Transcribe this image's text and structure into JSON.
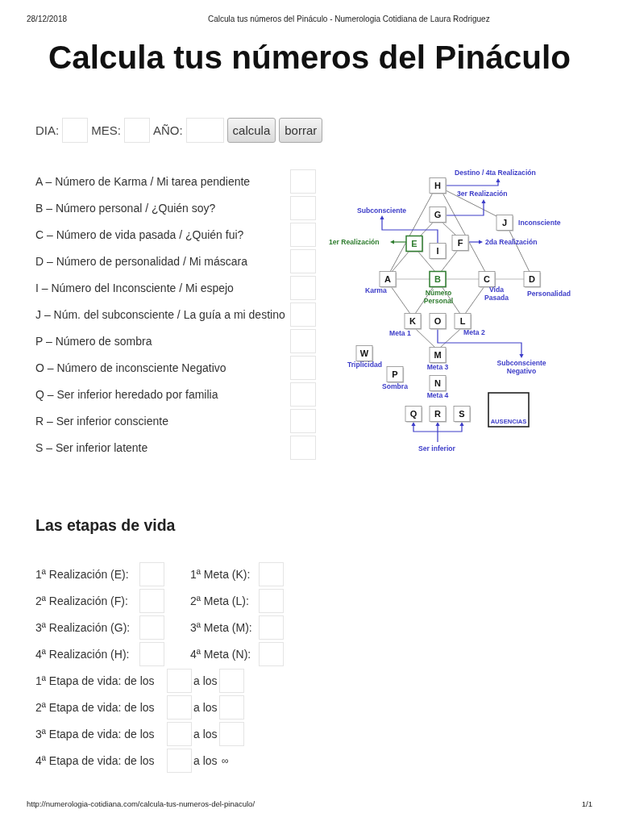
{
  "header": {
    "date": "28/12/2018",
    "title": "Calcula tus números del Pináculo - Numerologia Cotidiana de Laura Rodriguez"
  },
  "title": "Calcula tus números del Pináculo",
  "date_form": {
    "fields": [
      {
        "label": "DIA:"
      },
      {
        "label": "MES:"
      },
      {
        "label": "AÑO:"
      }
    ],
    "buttons": [
      "calcula",
      "borrar"
    ]
  },
  "numbers": [
    "A – Número de Karma / Mi tarea pendiente",
    "B – Número personal / ¿Quién soy?",
    "C – Número de vida pasada / ¿Quién fui?",
    "D – Número de personalidad / Mi máscara",
    "I – Número del Inconsciente / Mi espejo",
    "J – Núm. del subconsciente / La guía a mi destino",
    "P – Número de sombra",
    "O – Número de inconsciente Negativo",
    "Q – Ser inferior heredado por familia",
    "R – Ser inferior consciente",
    "S – Ser inferior latente"
  ],
  "diagram": {
    "nodes": [
      {
        "letter": "H",
        "highlighted": false
      },
      {
        "letter": "G",
        "highlighted": false
      },
      {
        "letter": "J",
        "highlighted": false
      },
      {
        "letter": "E",
        "highlighted": true
      },
      {
        "letter": "I",
        "highlighted": false
      },
      {
        "letter": "F",
        "highlighted": false
      },
      {
        "letter": "A",
        "highlighted": false
      },
      {
        "letter": "B",
        "highlighted": true
      },
      {
        "letter": "C",
        "highlighted": false
      },
      {
        "letter": "D",
        "highlighted": false
      },
      {
        "letter": "K",
        "highlighted": false
      },
      {
        "letter": "O",
        "highlighted": false
      },
      {
        "letter": "L",
        "highlighted": false
      },
      {
        "letter": "W",
        "highlighted": false
      },
      {
        "letter": "M",
        "highlighted": false
      },
      {
        "letter": "P",
        "highlighted": false
      },
      {
        "letter": "N",
        "highlighted": false
      },
      {
        "letter": "Q",
        "highlighted": false
      },
      {
        "letter": "R",
        "highlighted": false
      },
      {
        "letter": "S",
        "highlighted": false
      }
    ],
    "labels": [
      {
        "lines": [
          "Destino / 4ta Realización"
        ],
        "highlighted": false
      },
      {
        "lines": [
          "3er Realización"
        ],
        "highlighted": false
      },
      {
        "lines": [
          "Subconsciente"
        ],
        "highlighted": false
      },
      {
        "lines": [
          "Inconsciente"
        ],
        "highlighted": false
      },
      {
        "lines": [
          "1er Realización"
        ],
        "highlighted": true
      },
      {
        "lines": [
          "2da Realización"
        ],
        "highlighted": false
      },
      {
        "lines": [
          "Karma"
        ],
        "highlighted": false
      },
      {
        "lines": [
          "Número",
          "Personal"
        ],
        "highlighted": true
      },
      {
        "lines": [
          "Vida",
          "Pasada"
        ],
        "highlighted": false
      },
      {
        "lines": [
          "Personalidad"
        ],
        "highlighted": false
      },
      {
        "lines": [
          "Meta 1"
        ],
        "highlighted": false
      },
      {
        "lines": [
          "Meta 2"
        ],
        "highlighted": false
      },
      {
        "lines": [
          "Triplicidad"
        ],
        "highlighted": false
      },
      {
        "lines": [
          "Meta 3"
        ],
        "highlighted": false
      },
      {
        "lines": [
          "Subconsciente",
          "Negativo"
        ],
        "highlighted": false
      },
      {
        "lines": [
          "Sombra"
        ],
        "highlighted": false
      },
      {
        "lines": [
          "Meta 4"
        ],
        "highlighted": false
      },
      {
        "lines": [
          "Ser inferior"
        ],
        "highlighted": false
      }
    ],
    "absences_box": {
      "label": "AUSENCIAS"
    }
  },
  "life_stages": {
    "heading": "Las etapas de vida",
    "rows": [
      {
        "achievement": "1ª Realización (E):",
        "goal": "1ª Meta (K):"
      },
      {
        "achievement": "2ª Realización (F):",
        "goal": "2ª Meta (L):"
      },
      {
        "achievement": "3ª Realización (G):",
        "goal": "3ª Meta (M):"
      },
      {
        "achievement": "4ª Realización (H):",
        "goal": "4ª Meta (N):"
      }
    ],
    "stages": [
      {
        "from_label": "1ª Etapa de vida: de los",
        "to_label": "a los",
        "kind": "field"
      },
      {
        "from_label": "2ª Etapa de vida: de los",
        "to_label": "a los",
        "kind": "field"
      },
      {
        "from_label": "3ª Etapa de vida: de los",
        "to_label": "a los",
        "kind": "field"
      },
      {
        "from_label": "4ª Etapa de vida: de los",
        "to_label": "a los",
        "kind": "text",
        "end": "∞"
      }
    ]
  },
  "footer": {
    "url": "http://numerologia-cotidiana.com/calcula-tus-numeros-del-pinaculo/",
    "page": "1/1"
  }
}
